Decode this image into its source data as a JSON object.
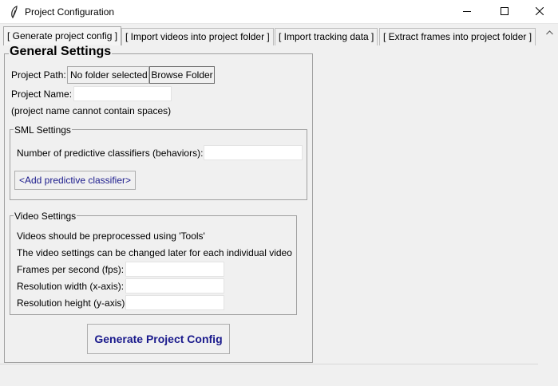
{
  "window": {
    "title": "Project Configuration"
  },
  "tabs": [
    {
      "label": "[ Generate project config ]"
    },
    {
      "label": "[ Import videos into project folder ]"
    },
    {
      "label": "[ Import tracking data ]"
    },
    {
      "label": "[ Extract frames into project folder ]"
    }
  ],
  "general": {
    "title": "General Settings",
    "project_path_label": "Project Path:",
    "project_path_value": "No folder selected",
    "browse_label": "Browse Folder",
    "project_name_label": "Project Name:",
    "project_name_value": "",
    "project_name_note": "(project name cannot contain spaces)"
  },
  "sml": {
    "title": "SML Settings",
    "num_classifiers_label": "Number of predictive classifiers (behaviors):",
    "num_classifiers_value": "",
    "add_classifier_label": "<Add predictive classifier>"
  },
  "video": {
    "title": "Video Settings",
    "note1": "Videos should be preprocessed using 'Tools'",
    "note2": "The video settings can be changed later for each individual video",
    "fps_label": "Frames per second (fps):",
    "fps_value": "",
    "width_label": "Resolution width (x-axis):",
    "width_value": "",
    "height_label": "Resolution height (y-axis):",
    "height_value": ""
  },
  "actions": {
    "generate_label": "Generate Project Config"
  },
  "colors": {
    "button_text_navy": "#1a1a8c",
    "window_bg": "#f0f0f0"
  }
}
